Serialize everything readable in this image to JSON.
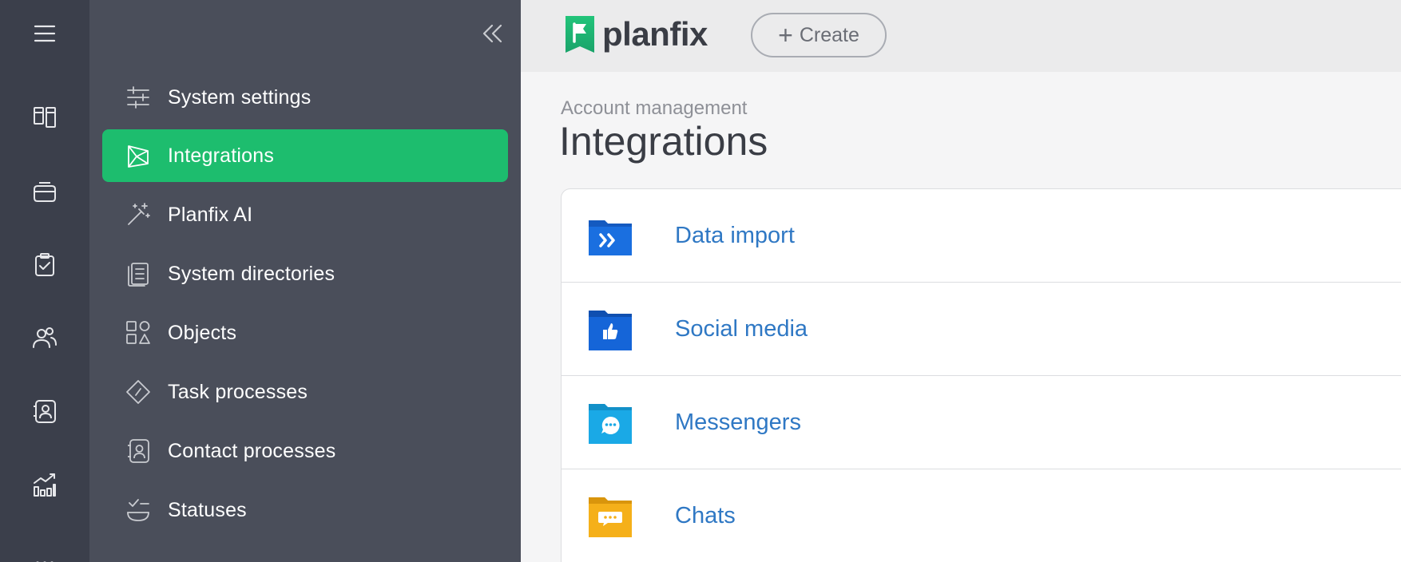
{
  "rail": {
    "items": [
      {
        "name": "menu-icon"
      },
      {
        "name": "boards-icon"
      },
      {
        "name": "inbox-icon"
      },
      {
        "name": "tasks-icon"
      },
      {
        "name": "contacts-icon"
      },
      {
        "name": "contact-card-icon"
      },
      {
        "name": "reports-icon"
      },
      {
        "name": "more-icon"
      }
    ],
    "background": "#3b3f4b"
  },
  "sidebar": {
    "background": "#4a4e5a",
    "active_color": "#1dbd6e",
    "items": [
      {
        "label": "System settings",
        "icon": "sliders-icon",
        "active": false
      },
      {
        "label": "Integrations",
        "icon": "integrations-icon",
        "active": true
      },
      {
        "label": "Planfix AI",
        "icon": "magic-wand-icon",
        "active": false
      },
      {
        "label": "System directories",
        "icon": "directory-icon",
        "active": false
      },
      {
        "label": "Objects",
        "icon": "shapes-icon",
        "active": false
      },
      {
        "label": "Task processes",
        "icon": "process-icon",
        "active": false
      },
      {
        "label": "Contact processes",
        "icon": "contact-process-icon",
        "active": false
      },
      {
        "label": "Statuses",
        "icon": "statuses-icon",
        "active": false
      }
    ]
  },
  "topbar": {
    "logo_text": "planfix",
    "create_label": "Create"
  },
  "main": {
    "breadcrumb": "Account management",
    "title": "Integrations",
    "rows": [
      {
        "label": "Data import",
        "icon": "data-import-folder-icon",
        "color": "#1a6fe0"
      },
      {
        "label": "Social media",
        "icon": "social-media-folder-icon",
        "color": "#1565d8"
      },
      {
        "label": "Messengers",
        "icon": "messengers-folder-icon",
        "color": "#1aa9e6"
      },
      {
        "label": "Chats",
        "icon": "chats-folder-icon",
        "color": "#f5b01a"
      }
    ]
  }
}
